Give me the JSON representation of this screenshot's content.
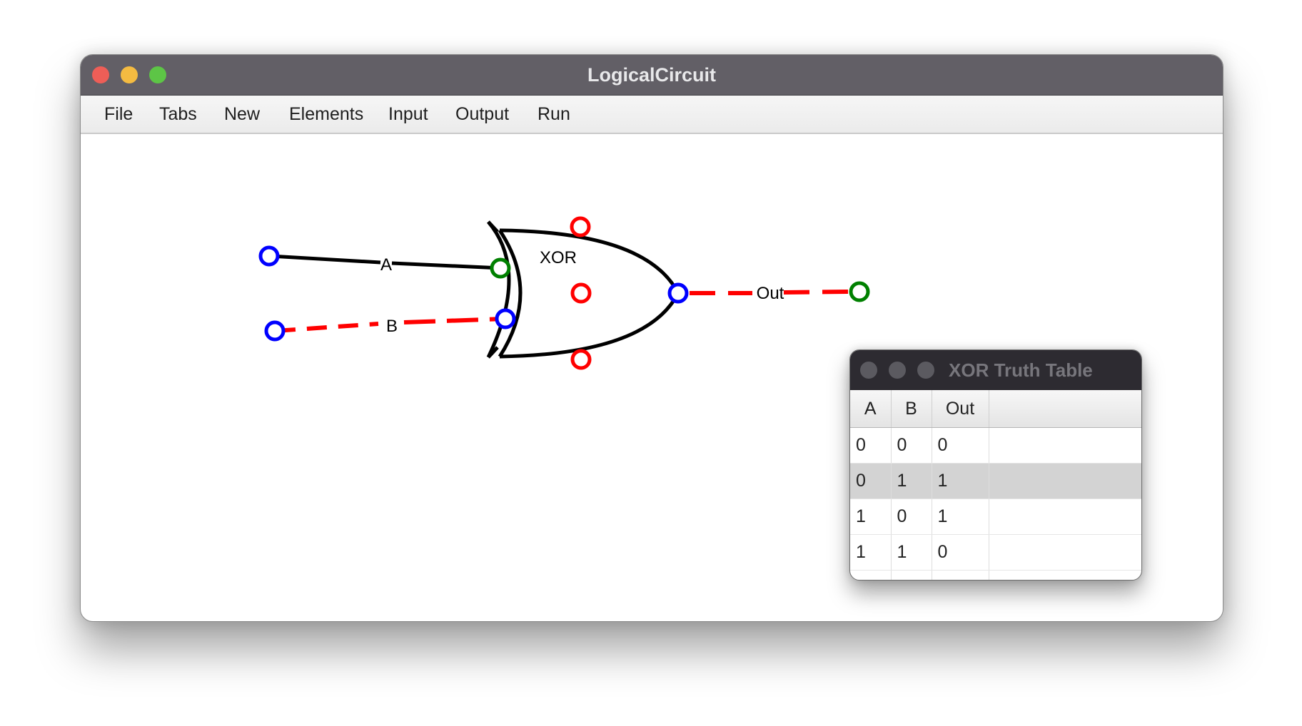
{
  "window": {
    "title": "LogicalCircuit",
    "controls": {
      "close_color": "#ee5e57",
      "minimize_color": "#f4bb41",
      "zoom_color": "#5dc546"
    }
  },
  "menubar": {
    "items": [
      "File",
      "Tabs",
      "New",
      "Elements",
      "Input",
      "Output",
      "Run"
    ]
  },
  "circuit": {
    "gate": {
      "label": "XOR"
    },
    "wires": [
      {
        "label": "A",
        "style": "solid",
        "color": "#000000"
      },
      {
        "label": "B",
        "style": "dashed",
        "color": "#ff0000"
      },
      {
        "label": "Out",
        "style": "dashed",
        "color": "#ff0000"
      }
    ],
    "pin_colors": {
      "blue": "#0000ff",
      "green": "#008000",
      "red": "#ff0000"
    }
  },
  "truth_table": {
    "title": "XOR Truth Table",
    "columns": [
      "A",
      "B",
      "Out"
    ],
    "rows": [
      [
        "0",
        "0",
        "0"
      ],
      [
        "0",
        "1",
        "1"
      ],
      [
        "1",
        "0",
        "1"
      ],
      [
        "1",
        "1",
        "0"
      ]
    ],
    "selected_row": 1
  }
}
